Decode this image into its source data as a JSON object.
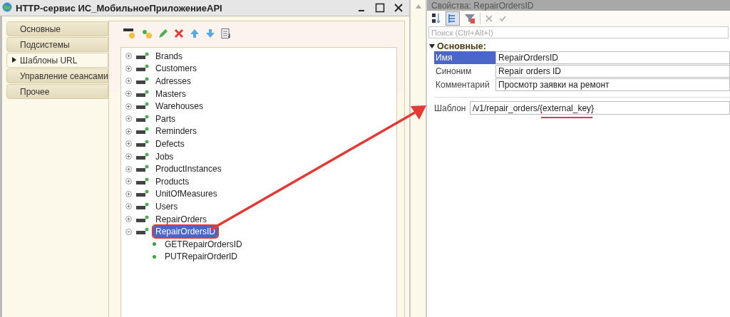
{
  "window": {
    "title": "HTTP-сервис ИС_МобильноеПриложениеAPI"
  },
  "tabs": [
    {
      "label": "Основные",
      "selected": false
    },
    {
      "label": "Подсистемы",
      "selected": false
    },
    {
      "label": "Шаблоны URL",
      "selected": true
    },
    {
      "label": "Управление сеансами",
      "selected": false
    },
    {
      "label": "Прочее",
      "selected": false
    }
  ],
  "tree": [
    {
      "label": "Brands",
      "expanded": false,
      "selected": false
    },
    {
      "label": "Customers",
      "expanded": false,
      "selected": false
    },
    {
      "label": "Adresses",
      "expanded": false,
      "selected": false
    },
    {
      "label": "Masters",
      "expanded": false,
      "selected": false
    },
    {
      "label": "Warehouses",
      "expanded": false,
      "selected": false
    },
    {
      "label": "Parts",
      "expanded": false,
      "selected": false
    },
    {
      "label": "Reminders",
      "expanded": false,
      "selected": false
    },
    {
      "label": "Defects",
      "expanded": false,
      "selected": false
    },
    {
      "label": "Jobs",
      "expanded": false,
      "selected": false
    },
    {
      "label": "ProductInstances",
      "expanded": false,
      "selected": false
    },
    {
      "label": "Products",
      "expanded": false,
      "selected": false
    },
    {
      "label": "UnitOfMeasures",
      "expanded": false,
      "selected": false
    },
    {
      "label": "Users",
      "expanded": false,
      "selected": false
    },
    {
      "label": "RepairOrders",
      "expanded": false,
      "selected": false
    },
    {
      "label": "RepairOrdersID",
      "expanded": true,
      "selected": true,
      "children": [
        {
          "label": "GETRepairOrdersID",
          "selected": false
        },
        {
          "label": "PUTRepairOrderID",
          "selected": false
        }
      ]
    }
  ],
  "properties": {
    "title": "Свойства: RepairOrdersID",
    "search": {
      "placeholder": "Поиск (Ctrl+Alt+I)"
    },
    "section": {
      "label": "Основные:",
      "expanded": true
    },
    "fields": [
      {
        "label": "Имя",
        "value": "RepairOrdersID",
        "selected": true
      },
      {
        "label": "Синоним",
        "value": "Repair orders ID",
        "selected": false
      },
      {
        "label": "Комментарий",
        "value": "Просмотр заявки на ремонт",
        "selected": false
      }
    ],
    "template": {
      "label": "Шаблон",
      "value": "/v1/repair_orders/{external_key}"
    }
  }
}
